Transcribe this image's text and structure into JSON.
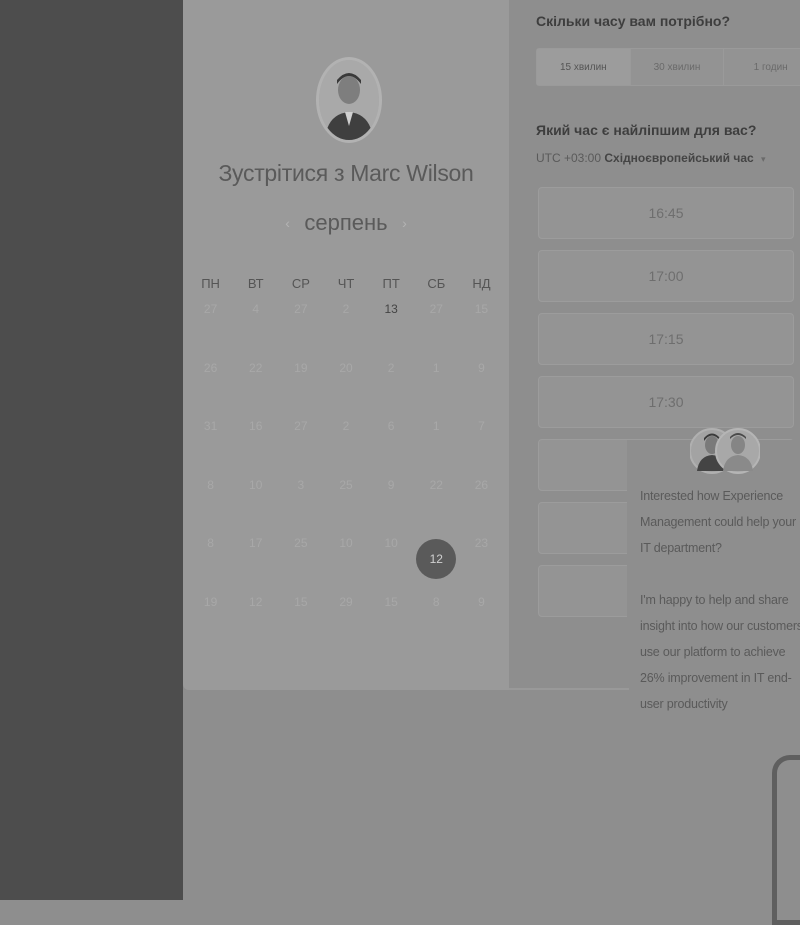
{
  "host": {
    "meet_title": "Зустрітися з Marc Wilson"
  },
  "calendar": {
    "month": "серпень",
    "prev_icon": "‹",
    "next_icon": "›",
    "weekdays": [
      "ПН",
      "ВТ",
      "СР",
      "ЧТ",
      "ПТ",
      "СБ",
      "НД"
    ],
    "days": [
      "27",
      "4",
      "27",
      "2",
      "13",
      "27",
      "15",
      "26",
      "22",
      "19",
      "20",
      "2",
      "1",
      "9",
      "31",
      "16",
      "27",
      "2",
      "6",
      "1",
      "7",
      "8",
      "10",
      "3",
      "25",
      "9",
      "22",
      "26",
      "8",
      "17",
      "25",
      "10",
      "10",
      "12",
      "23",
      "19",
      "12",
      "15",
      "29",
      "15",
      "8",
      "9"
    ],
    "available_day_index": 4,
    "selected_day_index": 33
  },
  "duration": {
    "question": "Скільки часу вам потрібно?",
    "options": [
      "15 хвилин",
      "30 хвилин",
      "1 годин"
    ],
    "selected_index": 0
  },
  "time": {
    "question": "Який час є найліпшим для вас?",
    "timezone_prefix": "UTC +03:00",
    "timezone_name": "Східноєвропейський час",
    "caret": "▾",
    "slots": [
      "16:45",
      "17:00",
      "17:15",
      "17:30",
      "",
      "",
      ""
    ]
  },
  "chat": {
    "paragraph_1": "Interested how Experience Management could help your IT department?",
    "paragraph_2": "I'm happy to help and share insight into how our customers use our platform to achieve 26% improvement in IT end-user productivity"
  }
}
